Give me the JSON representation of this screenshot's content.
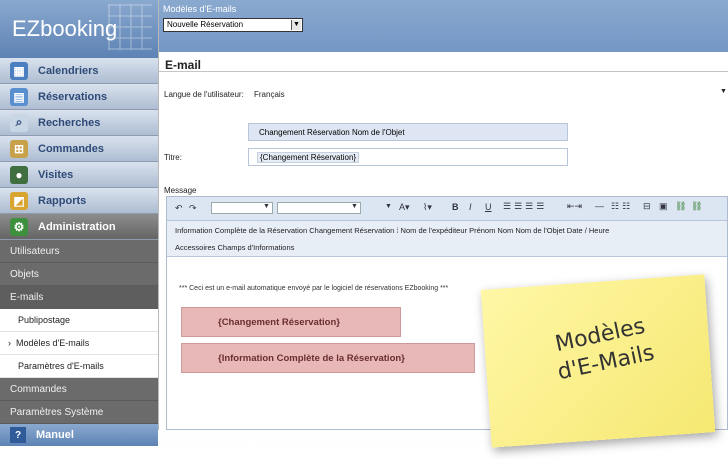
{
  "sidebar": {
    "logo": "EZbooking",
    "items": [
      {
        "label": "Calendriers",
        "icon": "calendar-icon"
      },
      {
        "label": "Réservations",
        "icon": "reservation-icon"
      },
      {
        "label": "Recherches",
        "icon": "search-icon"
      },
      {
        "label": "Commandes",
        "icon": "cart-icon"
      },
      {
        "label": "Visites",
        "icon": "visits-icon"
      },
      {
        "label": "Rapports",
        "icon": "reports-icon"
      },
      {
        "label": "Administration",
        "icon": "admin-icon"
      }
    ],
    "subitems": [
      "Utilisateurs",
      "Objets",
      "E-mails"
    ],
    "email_subitems": [
      "Publipostage",
      "Modèles d'E-mails",
      "Paramètres d'E-mails"
    ],
    "after_subitems": [
      "Commandes",
      "Paramètres Système"
    ],
    "manual": "Manuel"
  },
  "main": {
    "header_title": "Modèles d'E-mails",
    "template_select": "Nouvelle Réservation",
    "section_title": "E-mail",
    "language_label": "Langue de l'utilisateur:",
    "language_value": "Français",
    "chips": "Changement Réservation   Nom de l'Objet",
    "title_label": "Titre:",
    "title_value": "{Changement Réservation}",
    "message_label": "Message",
    "toolbar_row2": "Information Complète de la Réservation  Changement Réservation  ⁞  Nom de l'expéditeur  Prénom  Nom  Nom de l'Objet  Date / Heure",
    "toolbar_row3": "Accessoires  Champs d'Informations",
    "body_line": "*** Ceci est un e-mail automatique envoyé par le logiciel de réservations EZbooking ***",
    "block1": "{Changement Réservation}",
    "block2": "{Information Complète de la Réservation}"
  },
  "postit": {
    "line1": "Modèles",
    "line2": "d'E-Mails"
  },
  "colors": {
    "sidebar_bg": "#6b6b6b",
    "brand_blue": "#7497c5",
    "pink_block": "#e8b7b7",
    "postit": "#f5e872"
  }
}
